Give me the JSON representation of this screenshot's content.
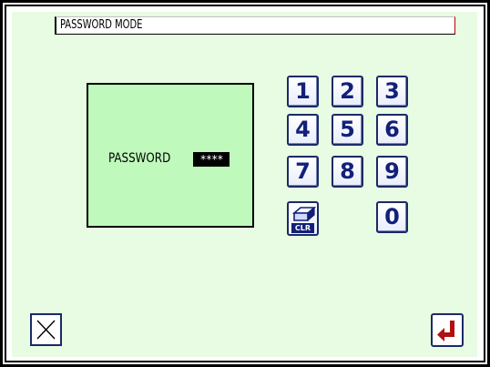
{
  "title": "PASSWORD MODE",
  "password": {
    "label": "PASSWORD",
    "masked_value": "****"
  },
  "keypad": {
    "keys": [
      "1",
      "2",
      "3",
      "4",
      "5",
      "6",
      "7",
      "8",
      "9",
      "0"
    ],
    "clear_label": "CLR"
  },
  "icons": {
    "cancel": "close-x-icon",
    "enter": "enter-return-icon",
    "clear": "eraser-icon"
  },
  "colors": {
    "screen_bg": "#e7fce3",
    "panel_bg": "#bff9bb",
    "key_text": "#13207a",
    "enter_arrow": "#b01010"
  }
}
